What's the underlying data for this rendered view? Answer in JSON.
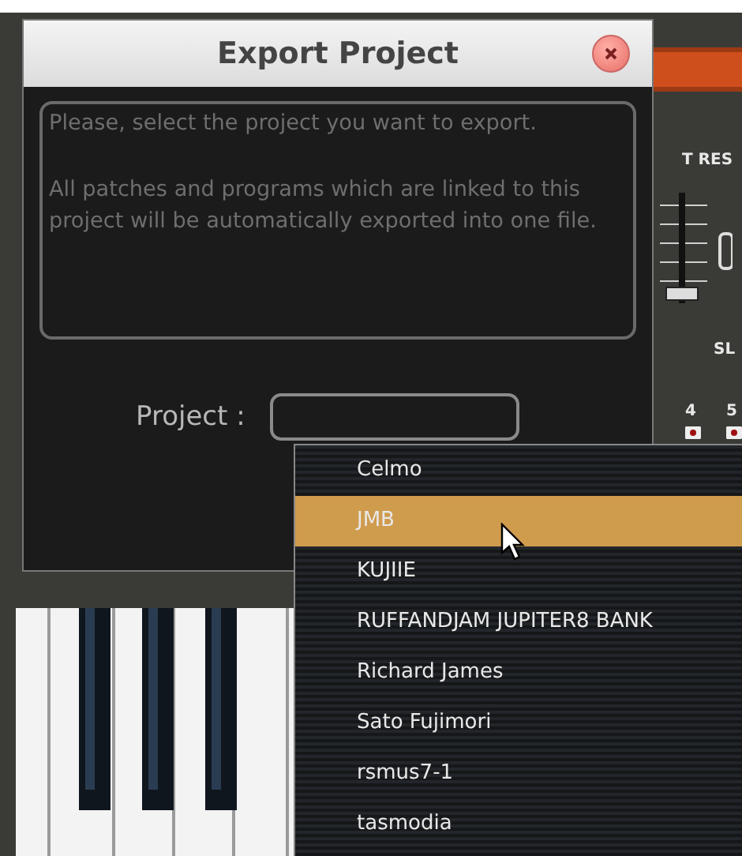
{
  "background": {
    "labels": [
      {
        "text": "T RES"
      },
      {
        "text": "SL"
      },
      {
        "text": "4"
      },
      {
        "text": "5"
      }
    ]
  },
  "dialog": {
    "title": "Export Project",
    "message": [
      "Please, select the project you want to export.",
      "All patches and programs which are linked to this project will be automatically exported into one file."
    ],
    "field_label": "Project :",
    "dropdown": {
      "items": [
        {
          "label": "Celmo",
          "selected": false
        },
        {
          "label": "JMB",
          "selected": true
        },
        {
          "label": "KUJIIE",
          "selected": false
        },
        {
          "label": "RUFFANDJAM JUPITER8 BANK",
          "selected": false
        },
        {
          "label": "Richard James",
          "selected": false
        },
        {
          "label": "Sato Fujimori",
          "selected": false
        },
        {
          "label": "rsmus7-1",
          "selected": false
        },
        {
          "label": "tasmodia",
          "selected": false
        }
      ]
    }
  }
}
